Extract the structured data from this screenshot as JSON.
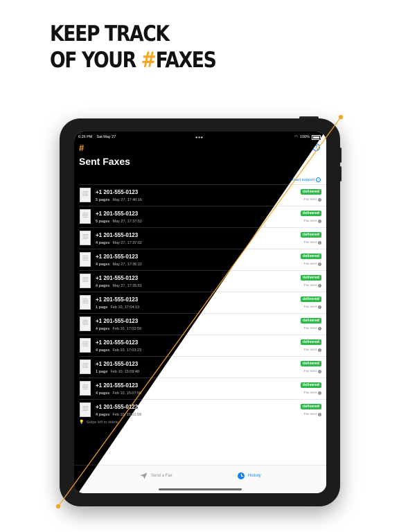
{
  "headline": {
    "line1": "KEEP TRACK",
    "line2_prefix": "OF YOUR ",
    "line2_hash": "#",
    "line2_suffix": "FAXES"
  },
  "status_bar": {
    "time": "6:26 PM",
    "date": "Sat May 27",
    "battery": "100%"
  },
  "app": {
    "logo": "#",
    "title": "Sent Faxes",
    "contact_support": "Contact support",
    "hint": "Swipe left to delete"
  },
  "faxes": [
    {
      "number": "+1 201-555-0123",
      "pages": "5 pages",
      "date": "May 27, 17:40:16",
      "status": "delivered",
      "sub": "Fax sent"
    },
    {
      "number": "+1 201-555-0123",
      "pages": "5 pages",
      "date": "May 27, 17:37:52",
      "status": "delivered",
      "sub": "Fax sent"
    },
    {
      "number": "+1 201-555-0123",
      "pages": "4 pages",
      "date": "May 27, 17:37:02",
      "status": "delivered",
      "sub": "Fax sent"
    },
    {
      "number": "+1 201-555-0123",
      "pages": "4 pages",
      "date": "May 27, 17:36:22",
      "status": "delivered",
      "sub": "Fax sent"
    },
    {
      "number": "+1 201-555-0123",
      "pages": "4 pages",
      "date": "May 27, 17:35:51",
      "status": "delivered",
      "sub": "Fax sent"
    },
    {
      "number": "+1 201-555-0123",
      "pages": "1 page",
      "date": "Feb 10, 17:04:13",
      "status": "delivered",
      "sub": "Fax sent"
    },
    {
      "number": "+1 201-555-0123",
      "pages": "4 pages",
      "date": "Feb 10, 17:02:59",
      "status": "delivered",
      "sub": "Fax sent"
    },
    {
      "number": "+1 201-555-0123",
      "pages": "4 pages",
      "date": "Feb 10, 17:03:23",
      "status": "delivered",
      "sub": "Fax sent"
    },
    {
      "number": "+1 201-555-0123",
      "pages": "1 page",
      "date": "Feb 10, 15:09:48",
      "status": "delivered",
      "sub": "Fax sent"
    },
    {
      "number": "+1 201-555-0123",
      "pages": "4 pages",
      "date": "Feb 10, 15:07:58",
      "status": "delivered",
      "sub": "Fax sent"
    },
    {
      "number": "+1 201-555-0123",
      "pages": "4 pages",
      "date": "Feb 10, 15:01:09",
      "status": "delivered",
      "sub": "Fax sent"
    }
  ],
  "tabs": {
    "send": "Send a Fax",
    "history": "History"
  },
  "colors": {
    "accent": "#f5a623",
    "link": "#0a84ff",
    "delivered": "#2fb84a"
  },
  "icons": [
    "hash-logo-icon",
    "help-icon",
    "question-icon",
    "info-icon",
    "bulb-icon",
    "paper-plane-icon",
    "clock-icon",
    "wifi-icon",
    "battery-icon"
  ]
}
